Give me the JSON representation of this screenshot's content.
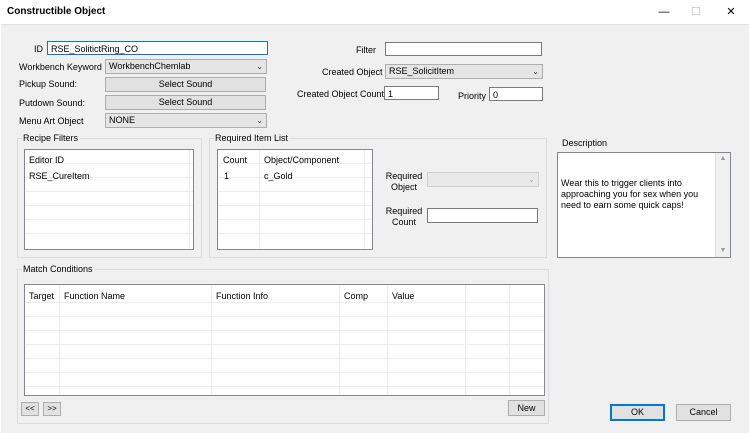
{
  "window": {
    "title": "Constructible Object"
  },
  "fields": {
    "id_label": "ID",
    "id_value": "RSE_SolitictRing_CO",
    "workbench_keyword_label": "Workbench Keyword",
    "workbench_keyword_value": "WorkbenchChemlab",
    "pickup_sound_label": "Pickup Sound:",
    "putdown_sound_label": "Putdown Sound:",
    "select_sound_label": "Select Sound",
    "menu_art_label": "Menu Art Object",
    "menu_art_value": "NONE",
    "filter_label": "Filter",
    "filter_value": "",
    "created_object_label": "Created Object",
    "created_object_value": "RSE_SolicitItem",
    "created_count_label": "Created Object Count",
    "created_count_value": "1",
    "priority_label": "Priority",
    "priority_value": "0"
  },
  "recipe_filters": {
    "label": "Recipe Filters",
    "header": "Editor ID",
    "items": [
      "RSE_CureItem"
    ]
  },
  "required_items": {
    "label": "Required Item List",
    "headers": [
      "Count",
      "Object/Component"
    ],
    "rows": [
      [
        "1",
        "c_Gold"
      ]
    ],
    "required_object_label": "Required\nObject",
    "required_count_label": "Required\nCount",
    "required_object_value": "",
    "required_count_value": ""
  },
  "description": {
    "label": "Description",
    "text": "Wear this to trigger clients into approaching you for sex when you need to earn some quick caps!"
  },
  "match_conditions": {
    "label": "Match Conditions",
    "headers": [
      "Target",
      "Function Name",
      "Function Info",
      "Comp",
      "Value"
    ],
    "prev_label": "<<",
    "next_label": ">>",
    "new_label": "New"
  },
  "buttons": {
    "ok": "OK",
    "cancel": "Cancel"
  },
  "icons": {
    "minimize": "minimize-icon",
    "maximize": "maximize-icon",
    "close": "close-icon",
    "dropdown": "chevron-down-icon"
  }
}
